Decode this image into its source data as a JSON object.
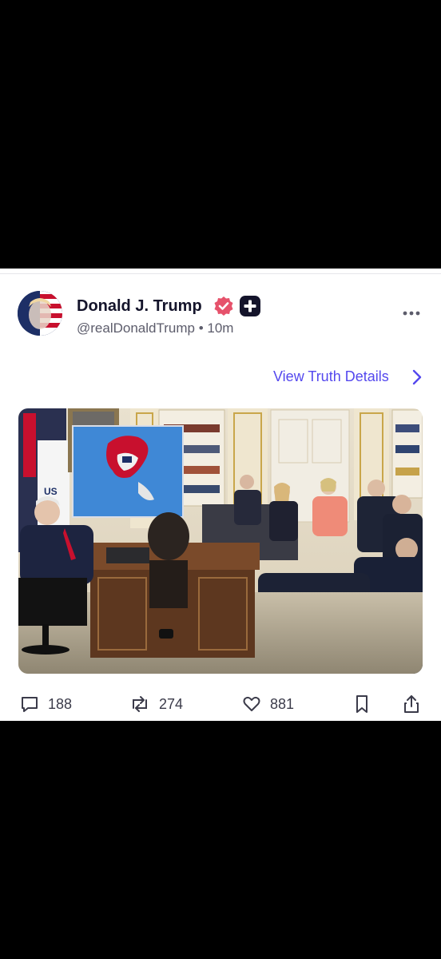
{
  "post": {
    "author_name": "Donald J. Trump",
    "handle": "@realDonaldTrump",
    "separator": "•",
    "time": "10m",
    "details_link": "View Truth Details",
    "photo_sign_text": "US"
  },
  "stats": {
    "replies": "188",
    "retruths": "274",
    "likes": "881"
  },
  "icons": {
    "verified": "verified-badge-icon",
    "plus": "plus-badge-icon",
    "more": "more-dots-icon",
    "chevron": "chevron-right-icon",
    "reply": "comment-icon",
    "retruth": "repost-icon",
    "like": "heart-icon",
    "bookmark": "bookmark-icon",
    "share": "share-icon"
  },
  "colors": {
    "accent": "#5448ee",
    "verified": "#e6526b",
    "text_primary": "#14142b",
    "text_secondary": "#5c5c6b"
  }
}
